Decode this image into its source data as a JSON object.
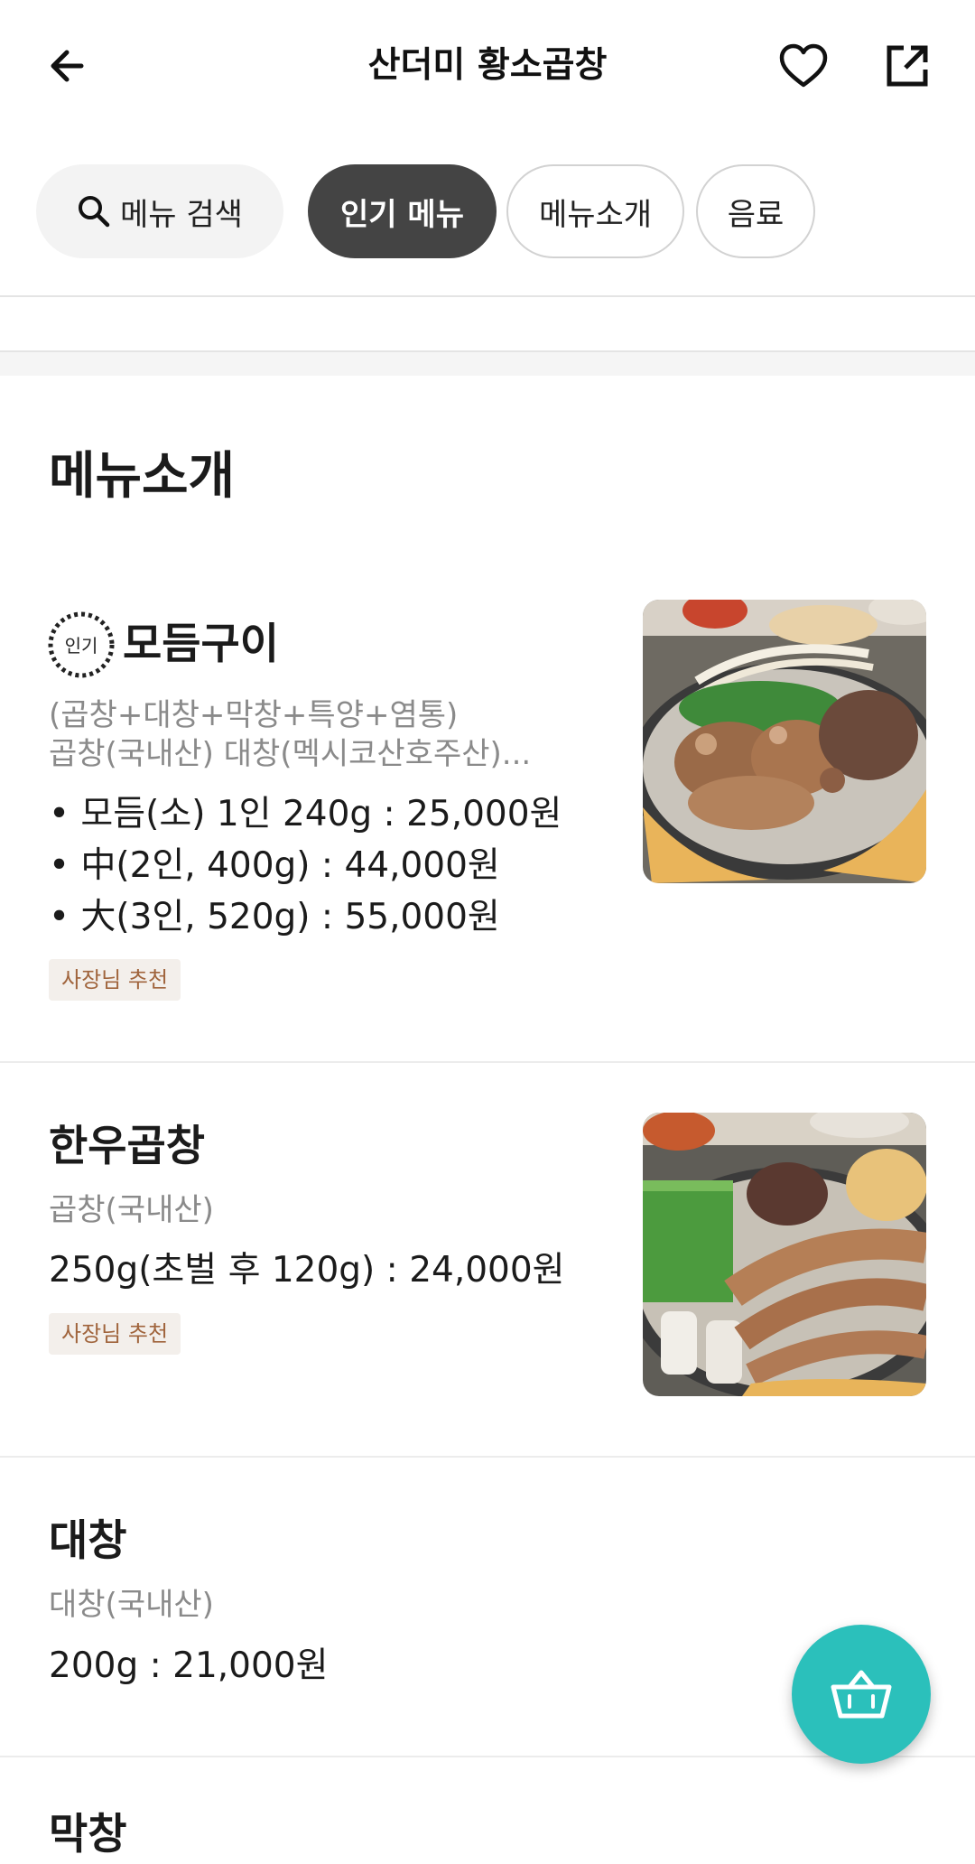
{
  "header": {
    "title": "산더미 황소곱창",
    "icons": [
      "back-arrow-icon",
      "heart-icon",
      "share-icon"
    ]
  },
  "chips": {
    "search_label": "메뉴 검색",
    "popular_label": "인기 메뉴",
    "menu_intro_label": "메뉴소개",
    "drinks_label": "음료"
  },
  "section_title": "메뉴소개",
  "items": [
    {
      "badge": "인기",
      "name": "모듬구이",
      "desc1": "(곱창+대창+막창+특양+염통)",
      "desc2": "곱창(국내산) 대창(멕시코산호주산)...",
      "prices": [
        "• 모듬(소) 1인 240g : 25,000원",
        "• 中(2인, 400g) : 44,000원",
        "• 大(3인, 520g) : 55,000원"
      ],
      "tag": "사장님 추천"
    },
    {
      "name": "한우곱창",
      "desc1": "곱창(국내산)",
      "price": "250g(초벌 후 120g) : 24,000원",
      "tag": "사장님 추천"
    },
    {
      "name": "대창",
      "desc1": "대창(국내산)",
      "price": "200g : 21,000원"
    },
    {
      "name": "막창"
    }
  ],
  "colors": {
    "accent": "#2bc0bb",
    "active_chip": "#444444",
    "tag_bg": "#f3efeb",
    "tag_text": "#a0643c"
  }
}
